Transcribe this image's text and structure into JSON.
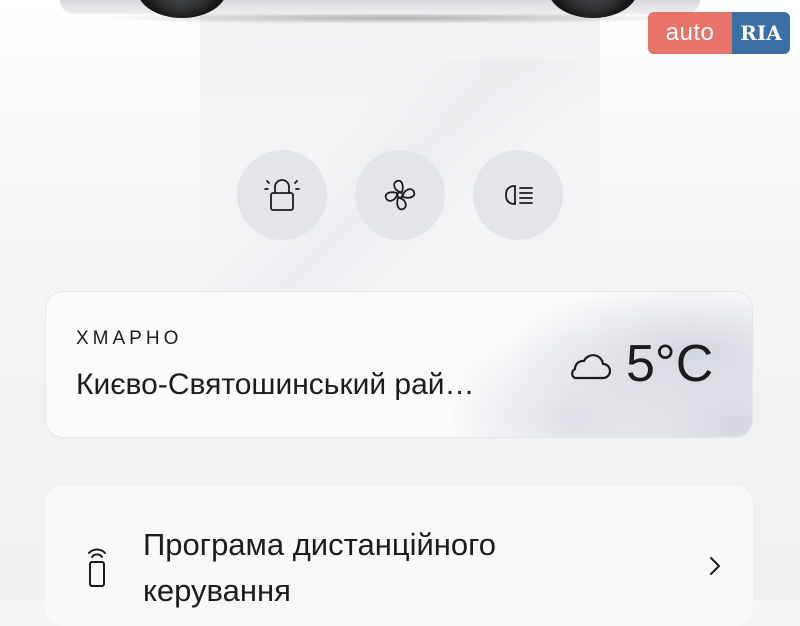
{
  "logo": {
    "auto": "auto",
    "ria": "RIA"
  },
  "controls": [
    {
      "icon": "lock-icon"
    },
    {
      "icon": "fan-icon"
    },
    {
      "icon": "headlight-icon"
    }
  ],
  "weather": {
    "condition": "ХМАРНО",
    "location": "Києво-Святошинський рай…",
    "temperature": "5°C",
    "icon": "cloud-icon"
  },
  "remote": {
    "label": "Програма дистанційного керування",
    "icon": "remote-key-icon",
    "chevron": "chevron-right-icon"
  }
}
